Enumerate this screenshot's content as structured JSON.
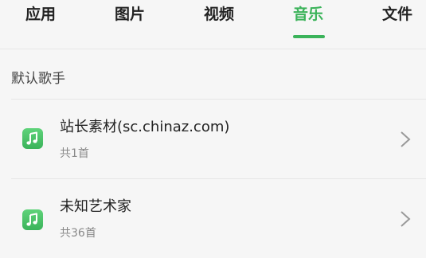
{
  "tabs": [
    {
      "label": "应用",
      "active": false
    },
    {
      "label": "图片",
      "active": false
    },
    {
      "label": "视频",
      "active": false
    },
    {
      "label": "音乐",
      "active": true
    },
    {
      "label": "文件",
      "active": false
    }
  ],
  "colors": {
    "accent": "#3bb35a",
    "text": "#222222",
    "subtext": "#888888",
    "background": "#f6f6f6"
  },
  "section": {
    "title": "默认歌手"
  },
  "artists": [
    {
      "name": "站长素材(sc.chinaz.com)",
      "count": "共1首",
      "icon": "music-note-icon"
    },
    {
      "name": "未知艺术家",
      "count": "共36首",
      "icon": "music-note-icon"
    }
  ]
}
